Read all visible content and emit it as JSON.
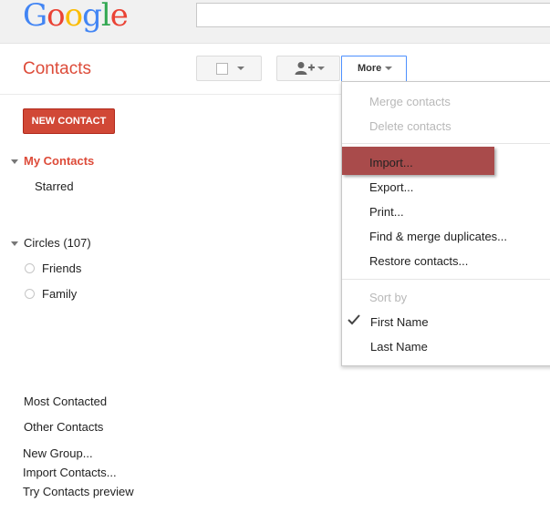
{
  "header": {
    "logo_letters": [
      {
        "char": "G",
        "color": "#4285f4"
      },
      {
        "char": "o",
        "color": "#ea4335"
      },
      {
        "char": "o",
        "color": "#fbbc05"
      },
      {
        "char": "g",
        "color": "#4285f4"
      },
      {
        "char": "l",
        "color": "#34a853"
      },
      {
        "char": "e",
        "color": "#ea4335"
      }
    ],
    "search_value": ""
  },
  "app": {
    "title": "Contacts",
    "accent_color": "#dd4b39"
  },
  "toolbar": {
    "more_label": "More"
  },
  "sidebar": {
    "new_contact_label": "NEW CONTACT",
    "my_contacts_label": "My Contacts",
    "starred_label": "Starred",
    "circles_label": "Circles (107)",
    "circles": [
      "Friends",
      "Family"
    ],
    "most_contacted_label": "Most Contacted",
    "other_contacts_label": "Other Contacts",
    "links": [
      "New Group...",
      "Import Contacts...",
      "Try Contacts preview"
    ]
  },
  "more_menu": {
    "merge_contacts": "Merge contacts",
    "delete_contacts": "Delete contacts",
    "import": "Import...",
    "export": "Export...",
    "print": "Print...",
    "find_merge_duplicates": "Find & merge duplicates...",
    "restore_contacts": "Restore contacts...",
    "sort_by": "Sort by",
    "first_name": "First Name",
    "last_name": "Last Name",
    "selected_sort": "First Name"
  }
}
